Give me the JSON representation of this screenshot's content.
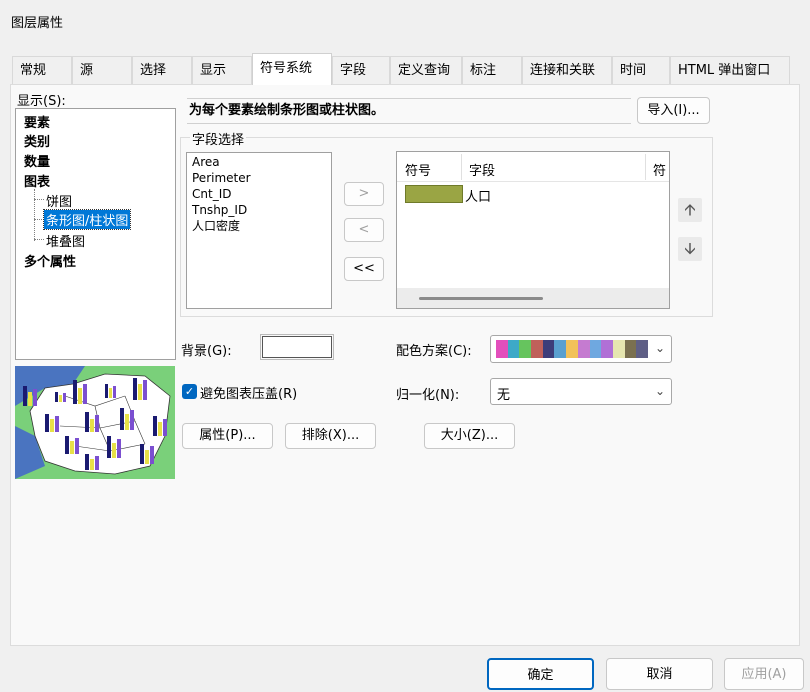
{
  "window": {
    "title": "图层属性"
  },
  "tabs": [
    {
      "label": "常规"
    },
    {
      "label": "源"
    },
    {
      "label": "选择"
    },
    {
      "label": "显示"
    },
    {
      "label": "符号系统"
    },
    {
      "label": "字段"
    },
    {
      "label": "定义查询"
    },
    {
      "label": "标注"
    },
    {
      "label": "连接和关联"
    },
    {
      "label": "时间"
    },
    {
      "label": "HTML 弹出窗口"
    }
  ],
  "show": {
    "label": "显示(S):",
    "items": [
      {
        "label": "要素"
      },
      {
        "label": "类别"
      },
      {
        "label": "数量"
      },
      {
        "label": "图表"
      },
      {
        "label": "饼图"
      },
      {
        "label": "条形图/柱状图"
      },
      {
        "label": "堆叠图"
      },
      {
        "label": "多个属性"
      }
    ]
  },
  "description": "为每个要素绘制条形图或柱状图。",
  "import_button": "导入(I)...",
  "field_selection": {
    "label": "字段选择",
    "fields": [
      "Area",
      "Perimeter",
      "Cnt_ID",
      "Tnshp_ID",
      "人口密度"
    ],
    "move_right": ">",
    "move_left": "<",
    "move_all_left": "<<",
    "columns": [
      "符号",
      "字段",
      "符"
    ],
    "rows": [
      {
        "field": "人口",
        "color": "#9aa544"
      }
    ]
  },
  "background": {
    "label": "背景(G):",
    "color": "#ffffff"
  },
  "color_scheme": {
    "label": "配色方案(C):",
    "colors": [
      "#e34fbc",
      "#3da9c8",
      "#66c45e",
      "#c0605a",
      "#3d3d7a",
      "#5aa0d0",
      "#f2c15a",
      "#c57bd0",
      "#6fa8e0",
      "#b070d6",
      "#e6e6b0",
      "#7a7050",
      "#5f5f86"
    ]
  },
  "avoid_overlap": {
    "label": "避免图表压盖(R)",
    "checked": true
  },
  "normalization": {
    "label": "归一化(N):",
    "value": "无"
  },
  "buttons": {
    "properties": "属性(P)...",
    "exclude": "排除(X)...",
    "size": "大小(Z)..."
  },
  "footer": {
    "ok": "确定",
    "cancel": "取消",
    "apply": "应用(A)"
  },
  "colors": {
    "accent": "#0067c0",
    "selection": "#0078d7",
    "map_water": "#4a74c0",
    "map_land": "#ffffff",
    "map_outer": "#7ad07a"
  }
}
